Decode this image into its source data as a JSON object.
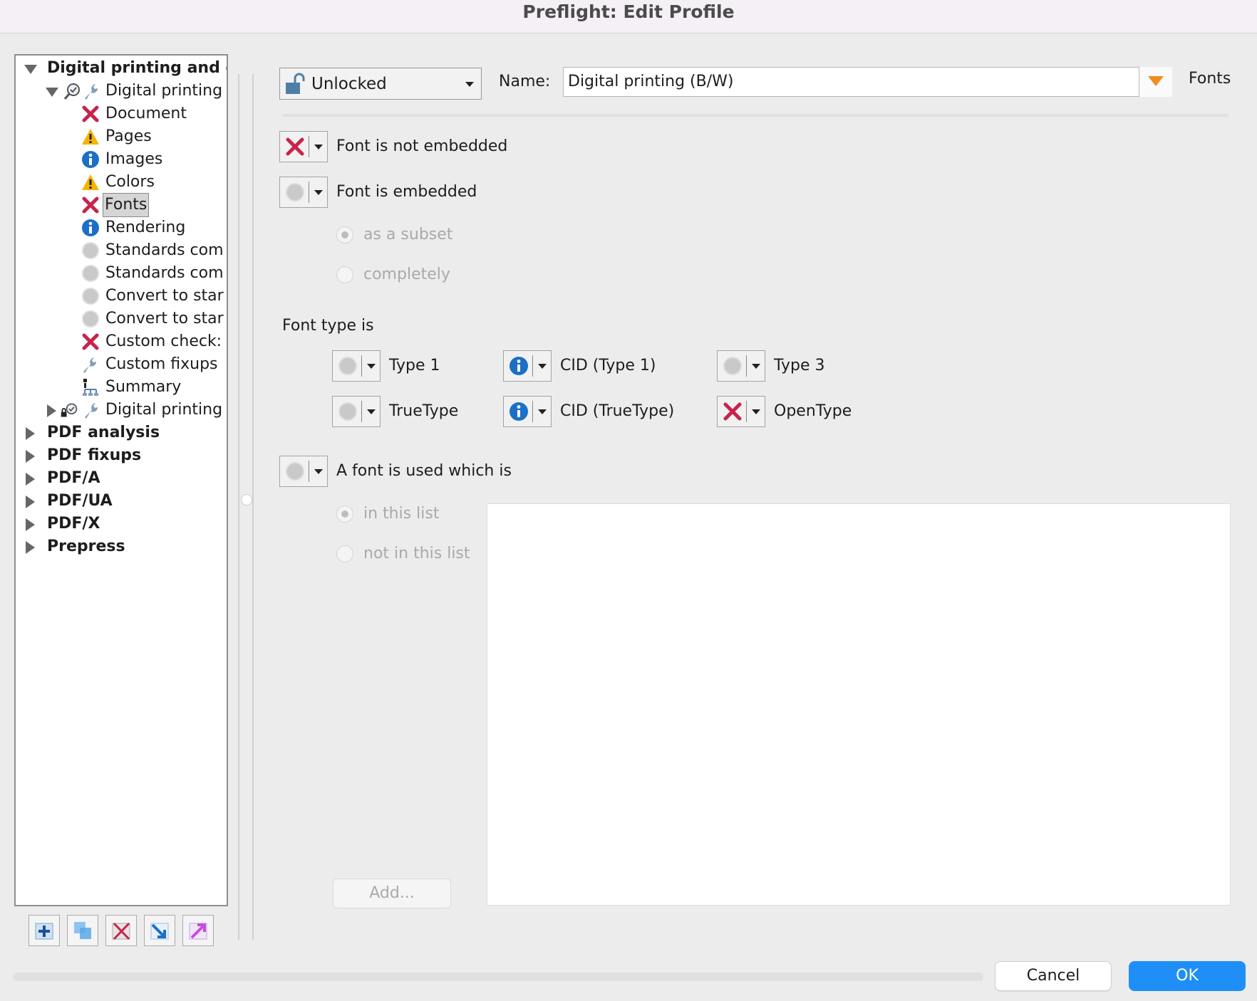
{
  "window": {
    "title": "Preflight: Edit Profile"
  },
  "tree": {
    "root_label": "Digital printing and onl",
    "profile_label": "Digital printing",
    "children": [
      {
        "label": "Document",
        "status": "error"
      },
      {
        "label": "Pages",
        "status": "warning"
      },
      {
        "label": "Images",
        "status": "info"
      },
      {
        "label": "Colors",
        "status": "warning"
      },
      {
        "label": "Fonts",
        "status": "error",
        "selected": true
      },
      {
        "label": "Rendering",
        "status": "info"
      },
      {
        "label": "Standards com",
        "status": "off"
      },
      {
        "label": "Standards com",
        "status": "off"
      },
      {
        "label": "Convert to star",
        "status": "off"
      },
      {
        "label": "Convert to star",
        "status": "off"
      },
      {
        "label": "Custom check:",
        "status": "error"
      },
      {
        "label": "Custom fixups",
        "status": "fixup"
      },
      {
        "label": "Summary",
        "status": "summary"
      }
    ],
    "profile2_label": "Digital printing",
    "groups": [
      "PDF analysis",
      "PDF fixups",
      "PDF/A",
      "PDF/UA",
      "PDF/X",
      "Prepress"
    ]
  },
  "toolbar_icons": [
    "add-icon",
    "duplicate-icon",
    "delete-icon",
    "import-icon",
    "export-icon"
  ],
  "header": {
    "lock_state": "Unlocked",
    "name_label": "Name:",
    "name_value": "Digital printing (B/W)",
    "section": "Fonts"
  },
  "checks": {
    "not_embedded": {
      "label": "Font is not embedded",
      "status": "error"
    },
    "embedded": {
      "label": "Font is embedded",
      "status": "off"
    },
    "embedded_options": [
      "as a subset",
      "completely"
    ],
    "font_type_heading": "Font type is",
    "font_types": [
      {
        "label": "Type 1",
        "status": "off"
      },
      {
        "label": "CID (Type 1)",
        "status": "info"
      },
      {
        "label": "Type 3",
        "status": "off"
      },
      {
        "label": "TrueType",
        "status": "off"
      },
      {
        "label": "CID (TrueType)",
        "status": "info"
      },
      {
        "label": "OpenType",
        "status": "error"
      }
    ],
    "font_used": {
      "label": "A font is used which is",
      "status": "off"
    },
    "list_options": [
      "in this list",
      "not in this list"
    ],
    "add_label": "Add..."
  },
  "footer": {
    "cancel": "Cancel",
    "ok": "OK"
  },
  "colors": {
    "error": "#c8234a",
    "warning": "#f5b400",
    "info": "#1b6fc6",
    "primary": "#1f8ff7"
  }
}
